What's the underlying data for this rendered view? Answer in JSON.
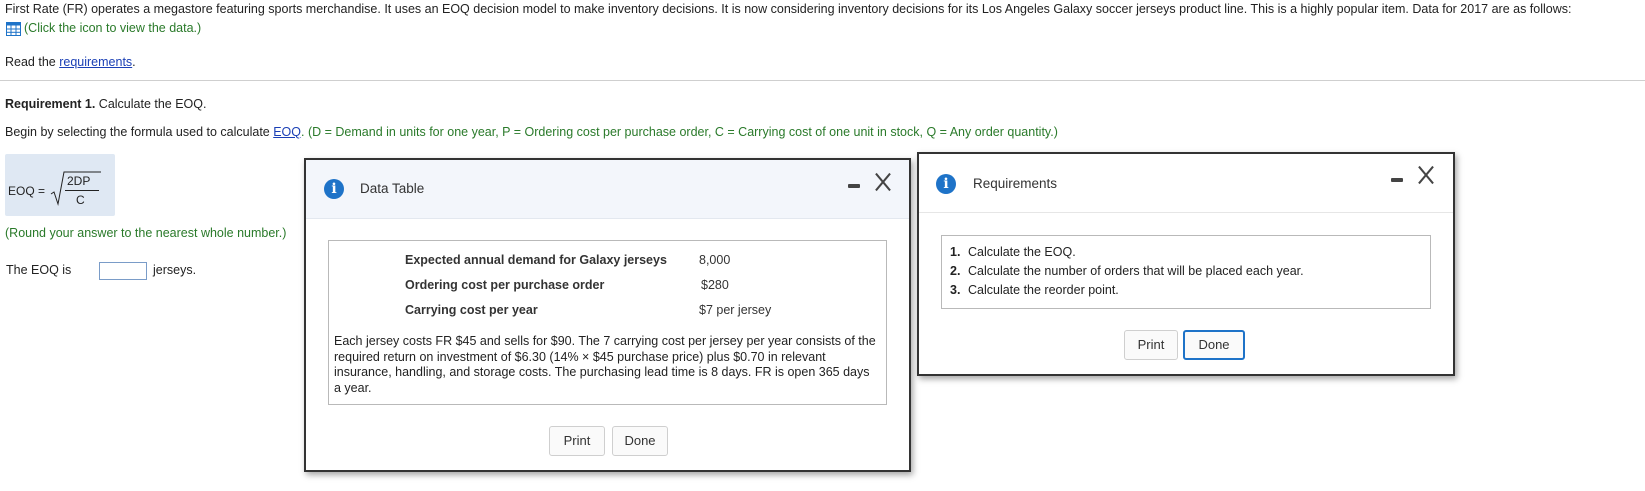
{
  "intro": {
    "text": "First Rate (FR) operates a megastore featuring sports merchandise. It uses an EOQ decision model to make inventory decisions. It is now considering inventory decisions for its Los Angeles Galaxy soccer jerseys product line. This is a highly popular item. Data for 2017 are as follows:",
    "click_hint": "(Click the icon to view the data.)",
    "read_prefix": "Read the ",
    "requirements_link": "requirements",
    "read_suffix": "."
  },
  "requirement1": {
    "title_bold": "Requirement 1.",
    "title_rest": " Calculate the EOQ.",
    "begin_prefix": "Begin by selecting the formula used to calculate ",
    "eoq_link": "EOQ",
    "begin_suffix": ". (D = Demand in units for one year, P = Ordering cost per purchase order, C = Carrying cost of one unit in stock, Q = Any order quantity.)",
    "formula_lhs": "EOQ =",
    "formula_num": "2DP",
    "formula_den": "C",
    "round_note": "(Round your answer to the nearest whole number.)",
    "answer_prefix": "The EOQ is",
    "answer_value": "",
    "answer_suffix": "jerseys."
  },
  "data_dialog": {
    "title": "Data Table",
    "rows": [
      {
        "label": "Expected annual demand for Galaxy jerseys",
        "value": "8,000"
      },
      {
        "label": "Ordering cost per purchase order",
        "value": "$280"
      },
      {
        "label": "Carrying cost per year",
        "value": "$7 per jersey"
      }
    ],
    "note": "Each jersey costs FR $45 and sells for $90. The 7 carrying cost per jersey per year consists of the required return on investment of $6.30 (14% × $45 purchase price) plus $0.70 in relevant insurance, handling, and storage costs. The purchasing lead time is 8 days. FR is open 365 days a year.",
    "print_label": "Print",
    "done_label": "Done"
  },
  "req_dialog": {
    "title": "Requirements",
    "items": [
      {
        "num": "1.",
        "text": "Calculate the EOQ."
      },
      {
        "num": "2.",
        "text": "Calculate the number of orders that will be placed each year."
      },
      {
        "num": "3.",
        "text": "Calculate the reorder point."
      }
    ],
    "print_label": "Print",
    "done_label": "Done"
  },
  "icons": {
    "table_icon": "grid-table-icon",
    "info_icon": "info-icon",
    "minimize_icon": "minimize-icon",
    "close_icon": "close-icon"
  },
  "colors": {
    "accent_blue": "#1e73c8",
    "green_text": "#2a7a2a",
    "link_blue": "#1a3fb5",
    "formula_bg": "#dfe8f3"
  }
}
